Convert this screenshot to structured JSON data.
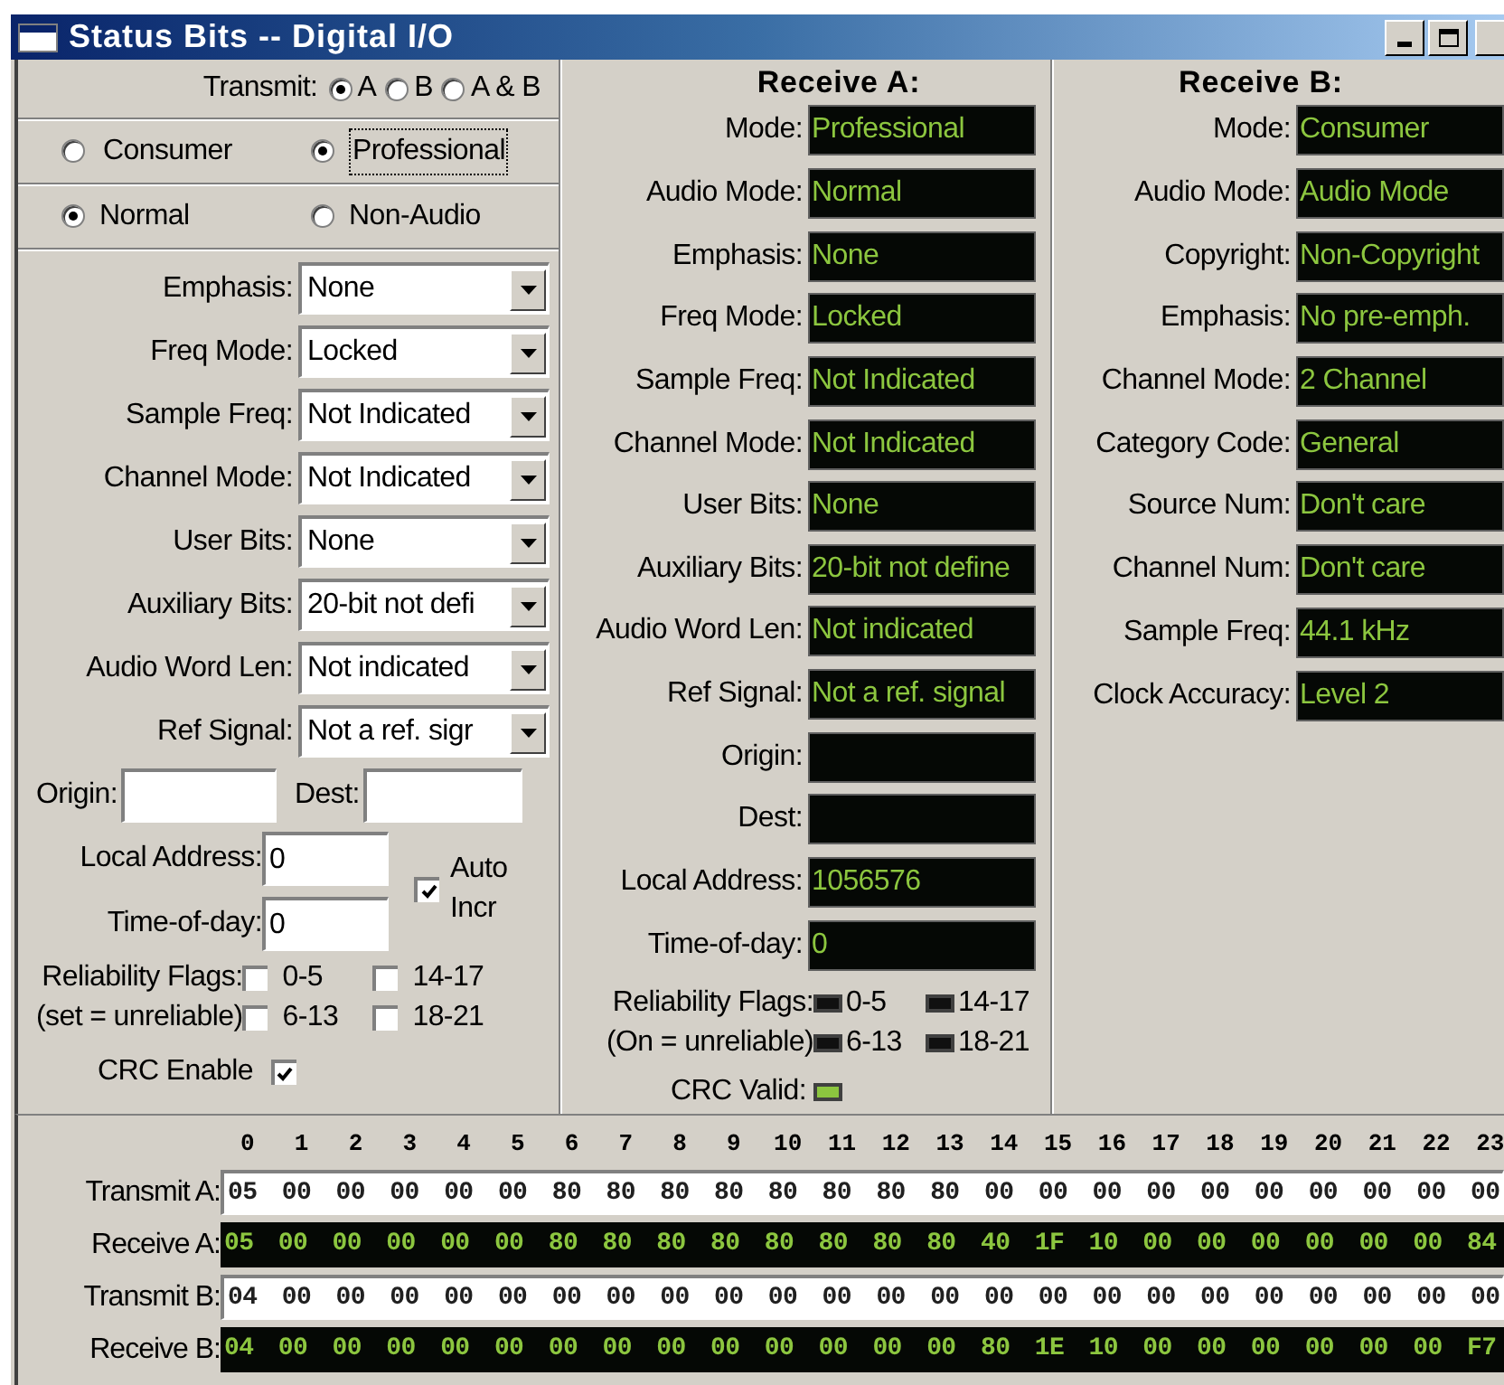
{
  "window": {
    "title": "Status Bits -- Digital I/O"
  },
  "transmit": {
    "label": "Transmit:",
    "options": [
      {
        "label": "A",
        "selected": true
      },
      {
        "label": "B",
        "selected": false
      },
      {
        "label": "A & B",
        "selected": false
      }
    ]
  },
  "mode_options": [
    {
      "label": "Consumer",
      "selected": false,
      "focused": false
    },
    {
      "label": "Professional",
      "selected": true,
      "focused": true
    }
  ],
  "audio_options": [
    {
      "label": "Normal",
      "selected": true
    },
    {
      "label": "Non-Audio",
      "selected": false
    }
  ],
  "settings": [
    {
      "label": "Emphasis:",
      "value": "None"
    },
    {
      "label": "Freq Mode:",
      "value": "Locked"
    },
    {
      "label": "Sample Freq:",
      "value": "Not Indicated"
    },
    {
      "label": "Channel Mode:",
      "value": "Not Indicated"
    },
    {
      "label": "User Bits:",
      "value": "None"
    },
    {
      "label": "Auxiliary Bits:",
      "value": "20-bit not defi"
    },
    {
      "label": "Audio Word Len:",
      "value": "Not indicated"
    },
    {
      "label": "Ref Signal:",
      "value": "Not a ref. sigr"
    }
  ],
  "origin": {
    "label": "Origin:"
  },
  "dest": {
    "label": "Dest:"
  },
  "local_address": {
    "label": "Local Address:",
    "value": "0"
  },
  "time_of_day": {
    "label": "Time-of-day:",
    "value": "0"
  },
  "auto_incr": {
    "label": "Auto Incr",
    "checked": true
  },
  "reliability": {
    "label": "Reliability Flags:",
    "note": "(set = unreliable)",
    "flags": [
      {
        "label": "0-5",
        "checked": false
      },
      {
        "label": "14-17",
        "checked": false
      },
      {
        "label": "6-13",
        "checked": false
      },
      {
        "label": "18-21",
        "checked": false
      }
    ]
  },
  "crc_enable": {
    "label": "CRC Enable",
    "checked": true
  },
  "receive_a": {
    "title": "Receive A:",
    "fields": [
      {
        "label": "Mode:",
        "value": "Professional"
      },
      {
        "label": "Audio Mode:",
        "value": "Normal"
      },
      {
        "label": "Emphasis:",
        "value": "None"
      },
      {
        "label": "Freq Mode:",
        "value": "Locked"
      },
      {
        "label": "Sample Freq:",
        "value": "Not Indicated"
      },
      {
        "label": "Channel Mode:",
        "value": "Not Indicated"
      },
      {
        "label": "User Bits:",
        "value": "None"
      },
      {
        "label": "Auxiliary Bits:",
        "value": "20-bit not define"
      },
      {
        "label": "Audio Word Len:",
        "value": "Not indicated"
      },
      {
        "label": "Ref Signal:",
        "value": "Not a ref. signal"
      },
      {
        "label": "Origin:"
      },
      {
        "label": "Dest:"
      },
      {
        "label": "Local Address:",
        "value": "1056576"
      },
      {
        "label": "Time-of-day:",
        "value": "0"
      }
    ],
    "reliability": {
      "label": "Reliability Flags:",
      "note": "(On = unreliable)",
      "flags": [
        {
          "label": "0-5",
          "on": false
        },
        {
          "label": "14-17",
          "on": false
        },
        {
          "label": "6-13",
          "on": false
        },
        {
          "label": "18-21",
          "on": false
        }
      ]
    },
    "crc_valid": {
      "label": "CRC Valid:",
      "on": true
    }
  },
  "receive_b": {
    "title": "Receive B:",
    "fields": [
      {
        "label": "Mode:",
        "value": "Consumer"
      },
      {
        "label": "Audio Mode:",
        "value": "Audio Mode"
      },
      {
        "label": "Copyright:",
        "value": "Non-Copyright"
      },
      {
        "label": "Emphasis:",
        "value": "No pre-emph."
      },
      {
        "label": "Channel Mode:",
        "value": "2 Channel"
      },
      {
        "label": "Category Code:",
        "value": "General"
      },
      {
        "label": "Source Num:",
        "value": "Don't care"
      },
      {
        "label": "Channel Num:",
        "value": "Don't care"
      },
      {
        "label": "Sample Freq:",
        "value": "44.1 kHz"
      },
      {
        "label": "Clock Accuracy:",
        "value": "Level 2"
      }
    ]
  },
  "hex": {
    "columns": [
      "0",
      "1",
      "2",
      "3",
      "4",
      "5",
      "6",
      "7",
      "8",
      "9",
      "10",
      "11",
      "12",
      "13",
      "14",
      "15",
      "16",
      "17",
      "18",
      "19",
      "20",
      "21",
      "22",
      "23"
    ],
    "rows": [
      {
        "label": "Transmit A:",
        "kind": "transmit",
        "bytes": [
          "05",
          "00",
          "00",
          "00",
          "00",
          "00",
          "80",
          "80",
          "80",
          "80",
          "80",
          "80",
          "80",
          "80",
          "00",
          "00",
          "00",
          "00",
          "00",
          "00",
          "00",
          "00",
          "00",
          "00"
        ]
      },
      {
        "label": "Receive A:",
        "kind": "receive",
        "bytes": [
          "05",
          "00",
          "00",
          "00",
          "00",
          "00",
          "80",
          "80",
          "80",
          "80",
          "80",
          "80",
          "80",
          "80",
          "40",
          "1F",
          "10",
          "00",
          "00",
          "00",
          "00",
          "00",
          "00",
          "84"
        ]
      },
      {
        "label": "Transmit B:",
        "kind": "transmit",
        "bytes": [
          "04",
          "00",
          "00",
          "00",
          "00",
          "00",
          "00",
          "00",
          "00",
          "00",
          "00",
          "00",
          "00",
          "00",
          "00",
          "00",
          "00",
          "00",
          "00",
          "00",
          "00",
          "00",
          "00",
          "00"
        ]
      },
      {
        "label": "Receive B:",
        "kind": "receive",
        "bytes": [
          "04",
          "00",
          "00",
          "00",
          "00",
          "00",
          "00",
          "00",
          "00",
          "00",
          "00",
          "00",
          "00",
          "00",
          "80",
          "1E",
          "10",
          "00",
          "00",
          "00",
          "00",
          "00",
          "00",
          "F7"
        ]
      }
    ]
  }
}
